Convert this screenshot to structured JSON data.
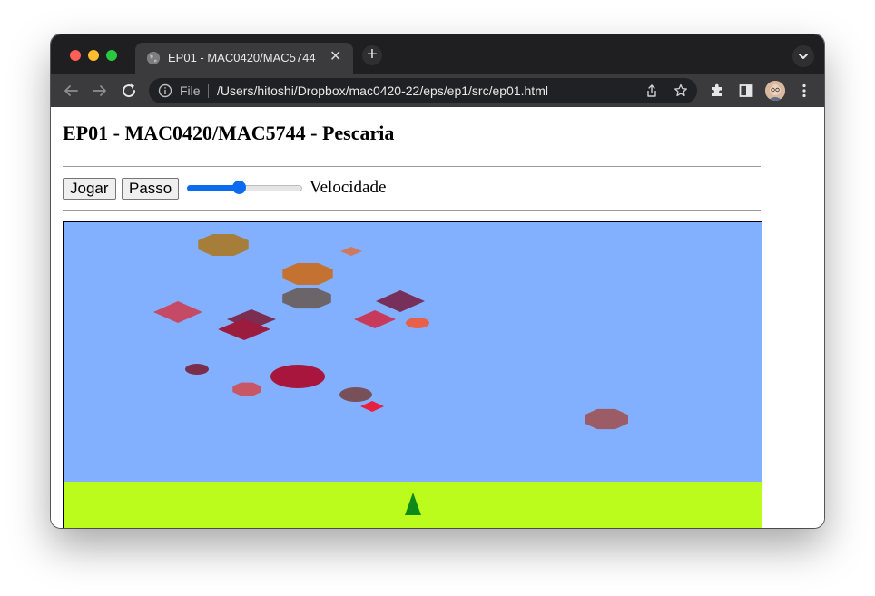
{
  "browser": {
    "tab_title": "EP01 - MAC0420/MAC5744",
    "tab_close_glyph": "✕",
    "new_tab_glyph": "+",
    "scheme_label": "File",
    "url": "/Users/hitoshi/Dropbox/mac0420-22/eps/ep1/src/ep01.html",
    "icons": [
      "back-icon",
      "forward-icon",
      "reload-icon",
      "info-icon",
      "share-icon",
      "bookmark-star-icon",
      "extensions-icon",
      "side-panel-icon",
      "profile-avatar",
      "more-menu-icon",
      "tab-search-icon",
      "globe-icon"
    ]
  },
  "page": {
    "title": "EP01 - MAC0420/MAC5744 - Pescaria",
    "controls": {
      "play_label": "Jogar",
      "step_label": "Passo",
      "speed_label": "Velocidade",
      "speed_value": 0.45
    }
  },
  "colors": {
    "sky": "#82b0fe",
    "ground": "#bbfc1c",
    "shooter": "#0d8a17",
    "slider_accent": "#0b6cf0"
  },
  "scene": {
    "fish": [
      {
        "shape": "octagon",
        "color": "#a67e3a"
      },
      {
        "shape": "diamond",
        "color": "#cf7860"
      },
      {
        "shape": "octagon",
        "color": "#c47232"
      },
      {
        "shape": "octagon",
        "color": "#6b6468"
      },
      {
        "shape": "diamond",
        "color": "#76305a"
      },
      {
        "shape": "diamond",
        "color": "#c44a66"
      },
      {
        "shape": "diamond",
        "color": "#7a2e52"
      },
      {
        "shape": "diamond",
        "color": "#9c1c40"
      },
      {
        "shape": "diamond",
        "color": "#c83a5c"
      },
      {
        "shape": "ellipse",
        "color": "#e8604a"
      },
      {
        "shape": "ellipse",
        "color": "#7a2e4c"
      },
      {
        "shape": "ellipse",
        "color": "#a8163e"
      },
      {
        "shape": "octagon",
        "color": "#c85664"
      },
      {
        "shape": "ellipse",
        "color": "#78505a"
      },
      {
        "shape": "diamond",
        "color": "#e6203e"
      },
      {
        "shape": "octagon",
        "color": "#9c5c66"
      }
    ]
  }
}
